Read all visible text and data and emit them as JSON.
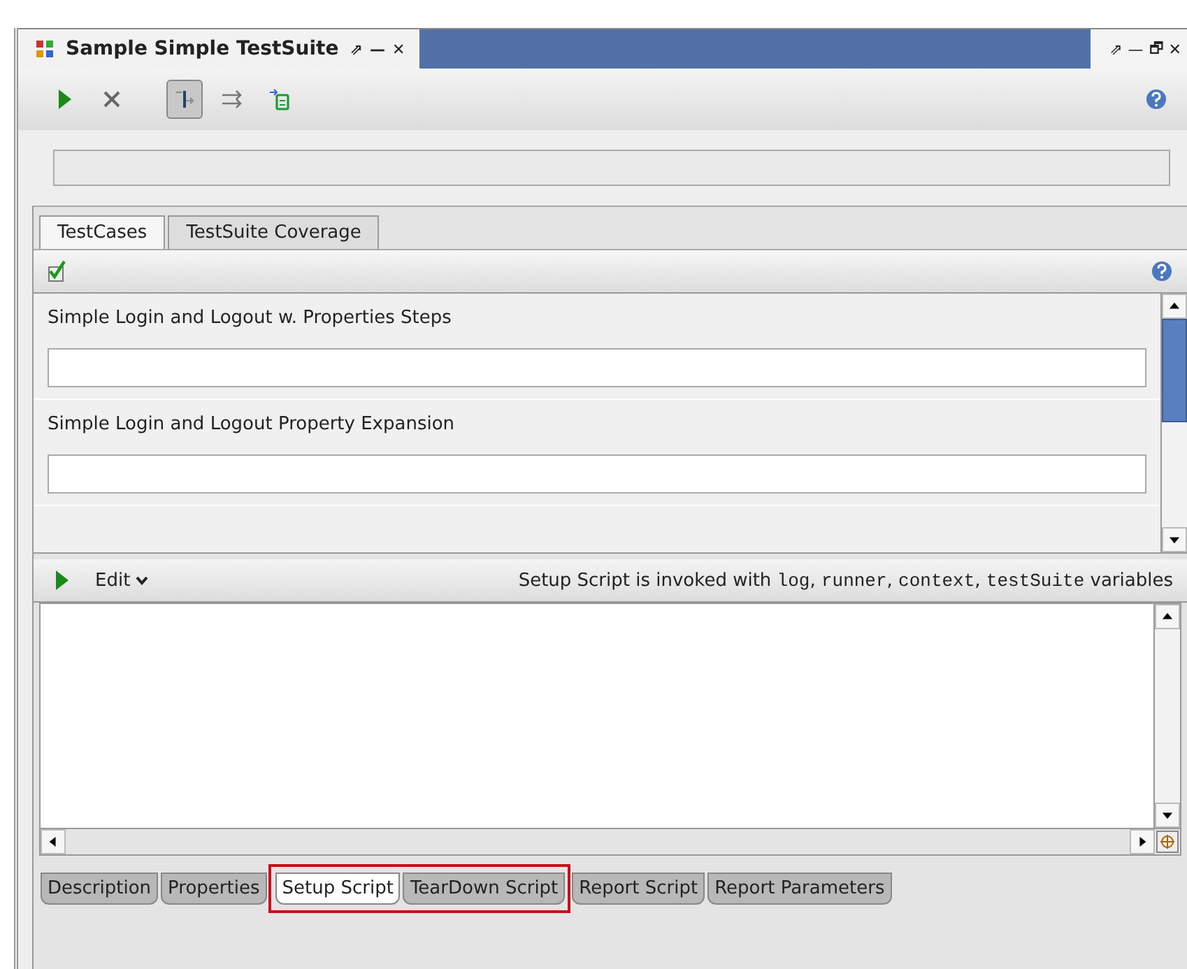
{
  "window": {
    "title": "Sample Simple TestSuite",
    "tab_controls": [
      "⇗",
      "—",
      "✕"
    ],
    "right_controls": [
      "⇗",
      "—",
      "🗗",
      "✕"
    ]
  },
  "toolbar": {
    "tools": [
      {
        "kind": "run",
        "selected": false
      },
      {
        "kind": "cancel",
        "selected": false
      },
      {
        "kind": "sequential",
        "selected": true
      },
      {
        "kind": "parallel",
        "selected": false
      },
      {
        "kind": "new",
        "selected": false
      }
    ]
  },
  "tabs": [
    {
      "label": "TestCases",
      "selected": true
    },
    {
      "label": "TestSuite Coverage",
      "selected": false
    }
  ],
  "test_cases": [
    {
      "name": "Simple Login and Logout w. Properties Steps"
    },
    {
      "name": "Simple Login and Logout Property Expansion"
    }
  ],
  "script_toolbar": {
    "edit_label": "Edit",
    "info": [
      {
        "kind": "text",
        "text": "Setup Script is invoked with "
      },
      {
        "kind": "code",
        "text": "log"
      },
      {
        "kind": "text",
        "text": ", "
      },
      {
        "kind": "code",
        "text": "runner"
      },
      {
        "kind": "text",
        "text": ", "
      },
      {
        "kind": "code",
        "text": "context"
      },
      {
        "kind": "text",
        "text": ", "
      },
      {
        "kind": "code",
        "text": "testSuite"
      },
      {
        "kind": "text",
        "text": " variables"
      }
    ]
  },
  "bottom_tabs": [
    {
      "label": "Description",
      "selected": false,
      "highlighted": false
    },
    {
      "label": "Properties",
      "selected": false,
      "highlighted": false
    },
    {
      "label": "Setup Script",
      "selected": true,
      "highlighted": true
    },
    {
      "label": "TearDown Script",
      "selected": false,
      "highlighted": true
    },
    {
      "label": "Report Script",
      "selected": false,
      "highlighted": false
    },
    {
      "label": "Report Parameters",
      "selected": false,
      "highlighted": false
    }
  ]
}
